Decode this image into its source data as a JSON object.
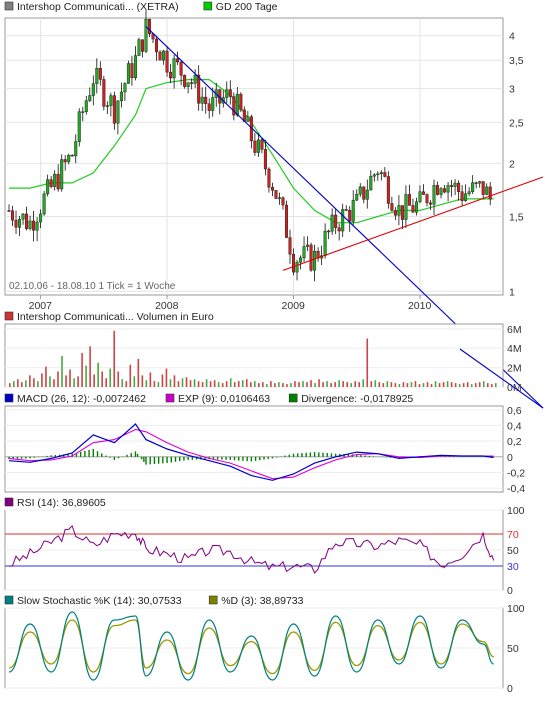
{
  "price_panel": {
    "legend": [
      {
        "label": "Intershop Communicati... (XETRA)",
        "color": "#808080"
      },
      {
        "label": "GD 200 Tage",
        "color": "#00cc00"
      }
    ],
    "period_text": "02.10.06 - 18.08.10   1 Tick = 1 Woche",
    "y_ticks": [
      "4",
      "3,5",
      "3",
      "2,5",
      "2",
      "1,5",
      "1"
    ],
    "x_ticks": [
      "2007",
      "2008",
      "2009",
      "2010"
    ]
  },
  "volume_panel": {
    "legend": [
      {
        "label": "Intershop Communicati... Volumen in Euro",
        "color": "#cc3333"
      }
    ],
    "y_ticks": [
      "6M",
      "4M",
      "2M",
      "0M"
    ]
  },
  "macd_panel": {
    "legend": [
      {
        "label": "MACD (26, 12): -0,0072462",
        "color": "#0000cc"
      },
      {
        "label": "EXP (9): 0,0106463",
        "color": "#cc00cc"
      },
      {
        "label": "Divergence: -0,0178925",
        "color": "#008000"
      }
    ],
    "y_ticks": [
      "0,6",
      "0,4",
      "0,2",
      "0",
      "-0,2",
      "-0,4"
    ]
  },
  "rsi_panel": {
    "legend": [
      {
        "label": "RSI (14): 36,89605",
        "color": "#800080"
      }
    ],
    "y_ticks": [
      "100",
      "70",
      "50",
      "30",
      "0"
    ],
    "upper_color": "#dd3333",
    "lower_color": "#3333dd"
  },
  "stoch_panel": {
    "legend": [
      {
        "label": "Slow Stochastic %K (14): 30,07533",
        "color": "#008080"
      },
      {
        "label": "%D (3): 38,89733",
        "color": "#808000"
      }
    ],
    "y_ticks": [
      "100",
      "50",
      "0"
    ]
  },
  "chart_data": [
    {
      "type": "line",
      "title": "Intershop Communicati... (XETRA)",
      "x": [
        "2006-10",
        "2006-12",
        "2007-02",
        "2007-04",
        "2007-06",
        "2007-08",
        "2007-10",
        "2007-11",
        "2008-01",
        "2008-03",
        "2008-05",
        "2008-07",
        "2008-09",
        "2008-11",
        "2009-01",
        "2009-03",
        "2009-05",
        "2009-07",
        "2009-09",
        "2009-11",
        "2010-01",
        "2010-03",
        "2010-05",
        "2010-07",
        "2010-08"
      ],
      "series": [
        {
          "name": "Intershop Communicati... (XETRA)",
          "values": [
            1.55,
            1.45,
            1.75,
            2.1,
            3.2,
            2.7,
            3.5,
            4.15,
            3.5,
            3.2,
            2.7,
            2.9,
            2.3,
            1.8,
            1.2,
            1.2,
            1.45,
            1.6,
            1.95,
            1.55,
            1.6,
            1.85,
            1.7,
            1.75,
            1.6
          ]
        },
        {
          "name": "GD 200 Tage",
          "values": [
            1.75,
            1.75,
            1.8,
            1.8,
            1.9,
            2.2,
            2.6,
            3.0,
            3.1,
            3.15,
            3.15,
            2.9,
            2.5,
            2.1,
            1.75,
            1.55,
            1.45,
            1.45,
            1.5,
            1.55,
            1.55,
            1.6,
            1.65,
            1.65,
            1.65
          ]
        }
      ],
      "ylim": [
        1,
        4.4
      ],
      "y_scale": "log",
      "grid": true,
      "trendlines": [
        {
          "color": "#0000cc",
          "from": {
            "x": "2007-11",
            "y": 4.2
          },
          "to": {
            "x": "2010-08",
            "y": 0.33
          }
        },
        {
          "color": "#dd0000",
          "from": {
            "x": "2008-12",
            "y": 1.12
          },
          "to": {
            "x": "2010-08",
            "y": 1.77
          }
        }
      ]
    },
    {
      "type": "bar",
      "title": "Intershop Communicati... Volumen in Euro",
      "values": [
        0.4,
        0.6,
        0.8,
        0.5,
        0.7,
        1.2,
        0.9,
        0.6,
        1.4,
        2.1,
        1.1,
        0.8,
        1.6,
        3.2,
        1.2,
        1.8,
        0.9,
        1.1,
        3.5,
        2.2,
        4.2,
        1.3,
        2.5,
        1.6,
        0.9,
        1.9,
        5.8,
        1.6,
        0.8,
        0.6,
        2.3,
        1.1,
        2.9,
        1.2,
        0.7,
        1.5,
        0.6,
        0.5,
        1.3,
        1.9,
        0.8,
        1.2,
        0.6,
        0.9,
        1.0,
        0.7,
        0.8,
        0.6,
        0.5,
        0.8,
        0.6,
        0.7,
        0.5,
        0.4,
        0.6,
        0.9,
        0.5,
        0.6,
        0.7,
        0.8,
        0.5,
        0.6,
        0.4,
        0.5,
        0.3,
        0.6,
        0.4,
        0.5,
        0.4,
        0.3,
        0.4,
        0.6,
        0.5,
        0.6,
        0.5,
        0.7,
        0.4,
        0.8,
        0.5,
        0.6,
        0.4,
        0.5,
        0.7,
        0.6,
        0.5,
        0.4,
        0.6,
        0.5,
        0.8,
        5.0,
        0.6,
        0.7,
        0.5,
        0.4,
        0.6,
        0.5,
        0.4,
        0.3,
        0.5,
        0.4,
        0.5,
        0.6,
        0.3,
        0.4,
        0.5,
        0.3,
        0.6,
        0.4,
        0.5,
        0.6,
        0.5,
        0.4,
        0.3,
        0.4,
        0.5,
        0.3,
        0.4,
        0.5,
        0.6,
        0.4,
        0.3,
        0.4
      ],
      "ylim": [
        0,
        6.5
      ]
    },
    {
      "type": "line",
      "title": "MACD (26, 12)",
      "x": [
        "2006-10",
        "2006-12",
        "2007-02",
        "2007-04",
        "2007-06",
        "2007-08",
        "2007-10",
        "2007-11",
        "2008-01",
        "2008-03",
        "2008-05",
        "2008-07",
        "2008-09",
        "2008-11",
        "2009-01",
        "2009-03",
        "2009-05",
        "2009-07",
        "2009-09",
        "2009-11",
        "2010-01",
        "2010-03",
        "2010-05",
        "2010-07",
        "2010-08"
      ],
      "series": [
        {
          "name": "MACD (26, 12)",
          "values": [
            -0.05,
            -0.07,
            -0.02,
            0.05,
            0.28,
            0.18,
            0.42,
            0.22,
            0.1,
            0.02,
            -0.05,
            -0.12,
            -0.24,
            -0.3,
            -0.22,
            -0.08,
            0.0,
            0.06,
            0.04,
            -0.02,
            0.0,
            0.02,
            0.01,
            0.01,
            -0.007
          ]
        },
        {
          "name": "EXP (9)",
          "values": [
            -0.02,
            -0.05,
            -0.04,
            0.01,
            0.18,
            0.22,
            0.35,
            0.32,
            0.18,
            0.06,
            -0.02,
            -0.08,
            -0.18,
            -0.28,
            -0.26,
            -0.14,
            -0.04,
            0.03,
            0.04,
            0.0,
            -0.01,
            0.01,
            0.01,
            0.01,
            0.011
          ]
        },
        {
          "name": "Divergence",
          "values": [
            -0.03,
            -0.02,
            0.02,
            0.04,
            0.1,
            -0.04,
            0.07,
            -0.1,
            -0.08,
            -0.04,
            -0.03,
            -0.04,
            -0.06,
            -0.02,
            0.04,
            0.06,
            0.04,
            0.03,
            0.0,
            -0.02,
            0.01,
            0.01,
            0.0,
            0.0,
            -0.018
          ]
        }
      ],
      "ylim": [
        -0.45,
        0.65
      ],
      "grid": true
    },
    {
      "type": "line",
      "title": "RSI (14)",
      "x": [
        "2006-10",
        "2006-12",
        "2007-02",
        "2007-04",
        "2007-06",
        "2007-08",
        "2007-10",
        "2007-11",
        "2008-01",
        "2008-03",
        "2008-05",
        "2008-07",
        "2008-09",
        "2008-11",
        "2009-01",
        "2009-03",
        "2009-05",
        "2009-07",
        "2009-09",
        "2009-11",
        "2010-01",
        "2010-03",
        "2010-05",
        "2010-07",
        "2010-08"
      ],
      "series": [
        {
          "name": "RSI (14)",
          "values": [
            32,
            45,
            60,
            75,
            55,
            70,
            72,
            52,
            45,
            38,
            50,
            48,
            35,
            28,
            30,
            26,
            60,
            58,
            55,
            62,
            56,
            32,
            45,
            70,
            37
          ]
        }
      ],
      "ylim": [
        0,
        100
      ],
      "reference_lines": [
        70,
        30
      ]
    },
    {
      "type": "line",
      "title": "Slow Stochastic",
      "x": [
        "2006-10",
        "2006-12",
        "2007-02",
        "2007-04",
        "2007-06",
        "2007-08",
        "2007-10",
        "2007-11",
        "2008-01",
        "2008-03",
        "2008-05",
        "2008-07",
        "2008-09",
        "2008-11",
        "2009-01",
        "2009-03",
        "2009-05",
        "2009-07",
        "2009-09",
        "2009-11",
        "2010-01",
        "2010-03",
        "2010-05",
        "2010-07",
        "2010-08"
      ],
      "series": [
        {
          "name": "Slow Stochastic %K (14)",
          "values": [
            20,
            80,
            20,
            95,
            10,
            85,
            90,
            15,
            70,
            10,
            85,
            20,
            65,
            10,
            80,
            15,
            90,
            20,
            85,
            30,
            90,
            25,
            85,
            55,
            30
          ]
        },
        {
          "name": "%D (3)",
          "values": [
            25,
            70,
            30,
            85,
            20,
            78,
            85,
            25,
            60,
            18,
            75,
            28,
            58,
            18,
            70,
            22,
            82,
            28,
            78,
            35,
            82,
            30,
            80,
            58,
            39
          ]
        }
      ],
      "ylim": [
        0,
        100
      ]
    }
  ]
}
